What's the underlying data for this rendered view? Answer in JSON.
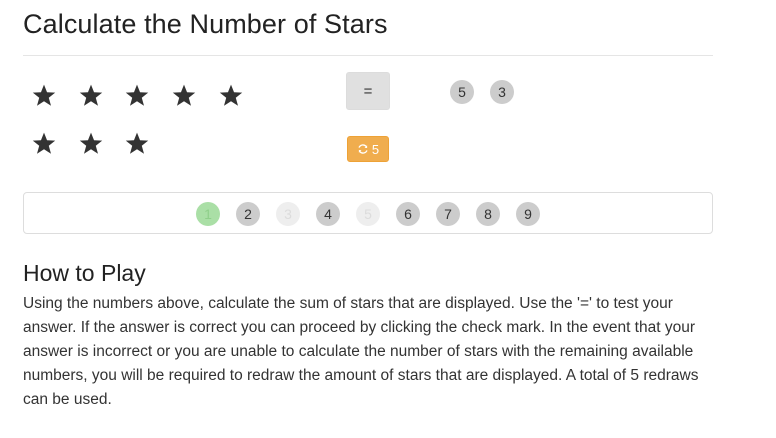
{
  "page": {
    "title": "Calculate the Number of Stars"
  },
  "stars": {
    "count": 8,
    "icon": "star-icon",
    "color": "#333333"
  },
  "controls": {
    "equals_label": "=",
    "redraw_icon": "refresh-icon",
    "redraws_remaining": "5",
    "redraw_color": "#f0ad4e"
  },
  "answer": {
    "selected_numbers": [
      "5",
      "3"
    ]
  },
  "numbers": [
    {
      "label": "1",
      "state": "selected"
    },
    {
      "label": "2",
      "state": "available"
    },
    {
      "label": "3",
      "state": "used"
    },
    {
      "label": "4",
      "state": "available"
    },
    {
      "label": "5",
      "state": "used"
    },
    {
      "label": "6",
      "state": "available"
    },
    {
      "label": "7",
      "state": "available"
    },
    {
      "label": "8",
      "state": "available"
    },
    {
      "label": "9",
      "state": "available"
    }
  ],
  "colors": {
    "selected": "#aadfa6",
    "available": "#cccccc",
    "used": "#eeeeee"
  },
  "how_to_play": {
    "heading": "How to Play",
    "text": "Using the numbers above, calculate the sum of stars that are displayed. Use the '=' to test your answer. If the answer is correct you can proceed by clicking the check mark. In the event that your answer is incorrect or you are unable to calculate the number of stars with the remaining available numbers, you will be required to redraw the amount of stars that are displayed. A total of 5 redraws can be used."
  }
}
